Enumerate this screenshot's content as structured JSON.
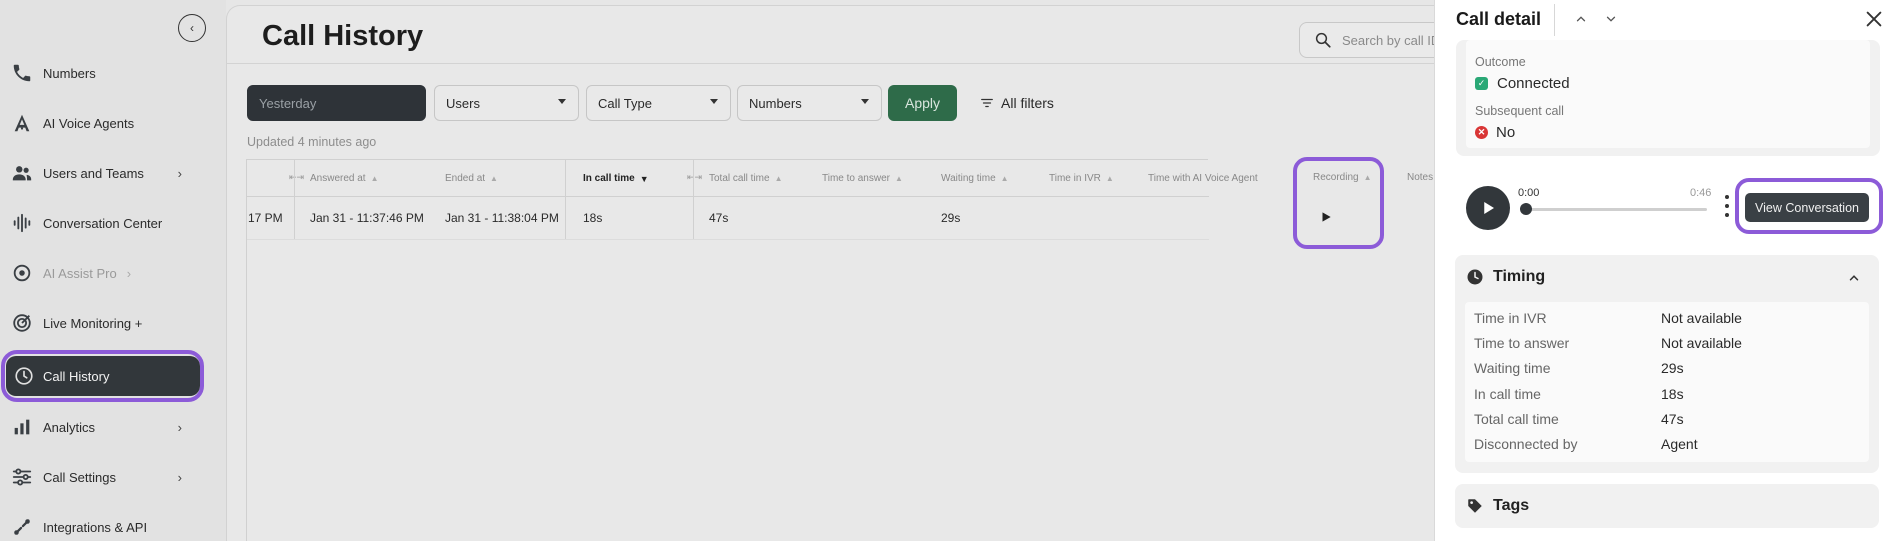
{
  "sidebar": {
    "collapse_icon": "chevron-left-icon",
    "items": [
      {
        "label": "Numbers",
        "icon": "phone-icon"
      },
      {
        "label": "AI Voice Agents",
        "icon": "ai-agent-icon"
      },
      {
        "label": "Users and Teams",
        "icon": "users-icon",
        "has_submenu": true
      },
      {
        "label": "Conversation Center",
        "icon": "waveform-icon"
      },
      {
        "label": "AI Assist Pro",
        "icon": "ai-assist-icon",
        "has_submenu": true,
        "disabled": true
      },
      {
        "label": "Live Monitoring +",
        "icon": "monitoring-icon"
      },
      {
        "label": "Call History",
        "icon": "history-icon",
        "active": true
      },
      {
        "label": "Analytics",
        "icon": "analytics-icon",
        "has_submenu": true
      },
      {
        "label": "Call Settings",
        "icon": "settings-sliders-icon",
        "has_submenu": true
      },
      {
        "label": "Integrations & API",
        "icon": "integrations-icon"
      }
    ]
  },
  "main": {
    "title": "Call History",
    "search_placeholder": "Search by call ID",
    "filters": {
      "date": "Yesterday",
      "users": "Users",
      "call_type": "Call Type",
      "numbers": "Numbers",
      "apply": "Apply",
      "all_filters": "All filters"
    },
    "updated": "Updated 4 minutes ago",
    "table": {
      "columns": [
        "Answered at",
        "Ended at",
        "In call time",
        "Total call time",
        "Time to answer",
        "Waiting time",
        "Time in IVR",
        "Time with AI Voice Agent",
        "Recording",
        "Notes"
      ],
      "rows": [
        {
          "partial_start": "17 PM",
          "answered_at": "Jan 31 - 11:37:46 PM",
          "ended_at": "Jan 31 - 11:38:04 PM",
          "in_call_time": "18s",
          "total_call_time": "47s",
          "time_to_answer": "",
          "waiting_time": "29s",
          "time_in_ivr": "",
          "time_with_ai": ""
        }
      ]
    }
  },
  "panel": {
    "title": "Call detail",
    "outcome_label": "Outcome",
    "outcome_value": "Connected",
    "subsequent_label": "Subsequent call",
    "subsequent_value": "No",
    "player": {
      "current": "0:00",
      "duration": "0:46",
      "progress": 0
    },
    "view_conversation": "View Conversation",
    "timing": {
      "title": "Timing",
      "rows": [
        {
          "label": "Time in IVR",
          "value": "Not available"
        },
        {
          "label": "Time to answer",
          "value": "Not available"
        },
        {
          "label": "Waiting time",
          "value": "29s"
        },
        {
          "label": "In call time",
          "value": "18s"
        },
        {
          "label": "Total call time",
          "value": "47s"
        },
        {
          "label": "Disconnected by",
          "value": "Agent"
        }
      ]
    },
    "tags_title": "Tags"
  },
  "colors": {
    "highlight": "#8c5bd8",
    "apply_green": "#2e6b49",
    "dark": "#32373b"
  }
}
